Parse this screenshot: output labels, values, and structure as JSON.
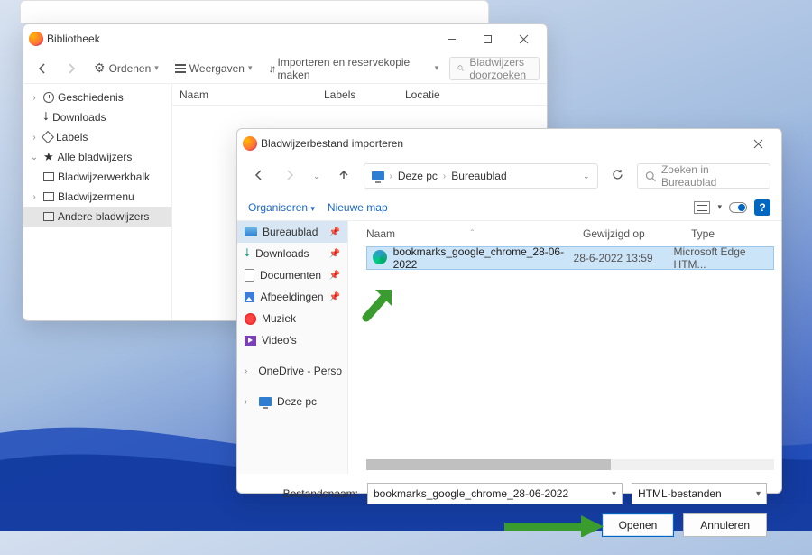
{
  "library": {
    "title": "Bibliotheek",
    "toolbar": {
      "organize": "Ordenen",
      "views": "Weergaven",
      "import": "Importeren en reservekopie maken",
      "search_placeholder": "Bladwijzers doorzoeken"
    },
    "tree": {
      "history": "Geschiedenis",
      "downloads": "Downloads",
      "labels": "Labels",
      "all_bookmarks": "Alle bladwijzers",
      "toolbar_folder": "Bladwijzerwerkbalk",
      "menu_folder": "Bladwijzermenu",
      "other_folder": "Andere bladwijzers"
    },
    "columns": {
      "name": "Naam",
      "labels": "Labels",
      "location": "Locatie"
    }
  },
  "dialog": {
    "title": "Bladwijzerbestand importeren",
    "breadcrumb": {
      "pc": "Deze pc",
      "desktop": "Bureaublad"
    },
    "search_placeholder": "Zoeken in Bureaublad",
    "toolbar": {
      "organize": "Organiseren",
      "new_folder": "Nieuwe map"
    },
    "tree": {
      "desktop": "Bureaublad",
      "downloads": "Downloads",
      "documents": "Documenten",
      "pictures": "Afbeeldingen",
      "music": "Muziek",
      "videos": "Video's",
      "onedrive": "OneDrive - Perso",
      "this_pc": "Deze pc"
    },
    "columns": {
      "name": "Naam",
      "modified": "Gewijzigd op",
      "type": "Type"
    },
    "file": {
      "name": "bookmarks_google_chrome_28-06-2022",
      "modified": "28-6-2022 13:59",
      "type": "Microsoft Edge HTM..."
    },
    "footer": {
      "filename_label": "Bestandsnaam:",
      "filename_value": "bookmarks_google_chrome_28-06-2022",
      "filter": "HTML-bestanden",
      "open": "Openen",
      "cancel": "Annuleren"
    }
  }
}
